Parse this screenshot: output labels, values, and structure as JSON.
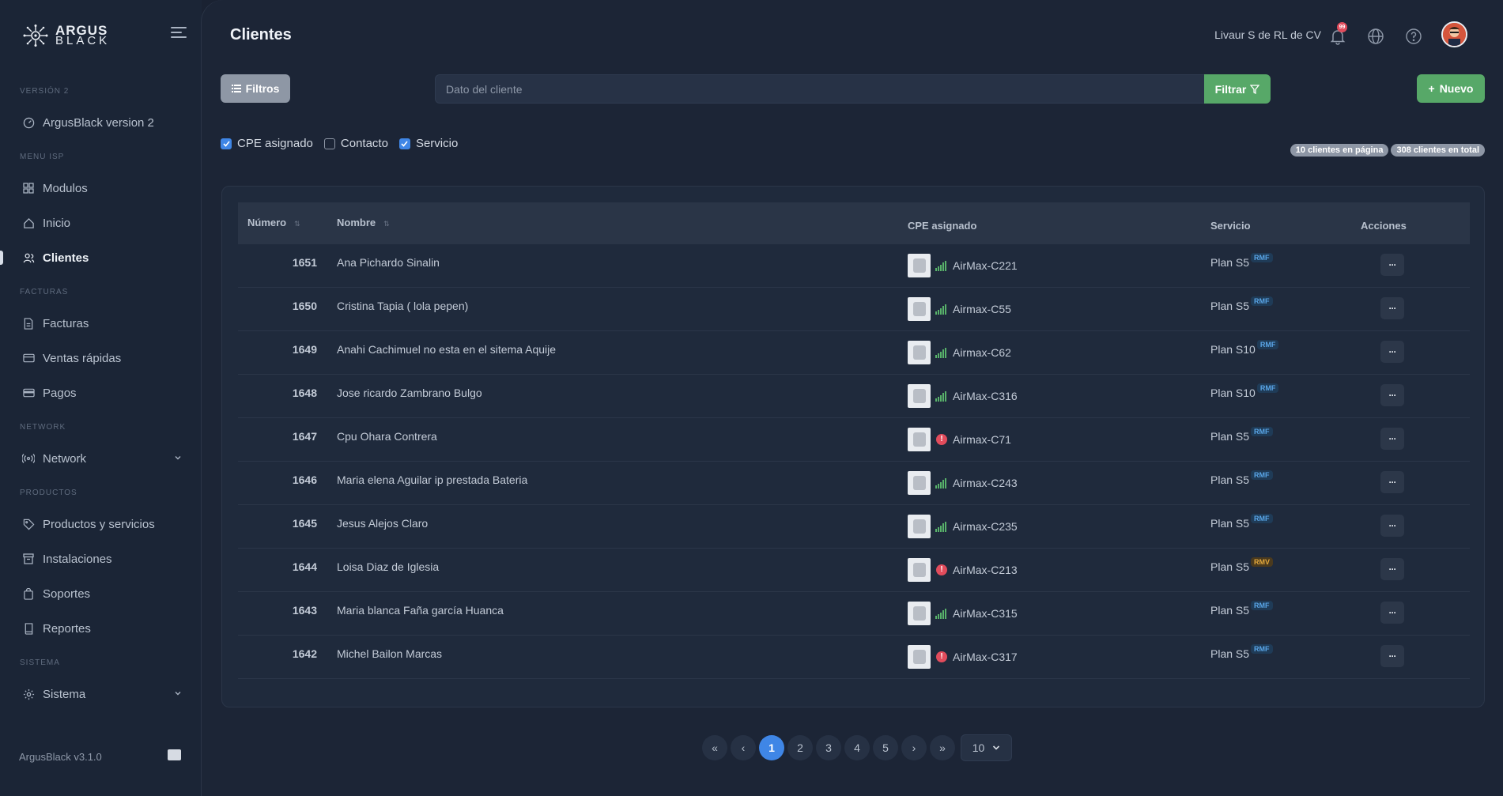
{
  "sidebar": {
    "logo_line1": "ARGUS",
    "logo_line2": "BLACK",
    "sections": [
      "VERSIÓN 2",
      "MENU ISP",
      "FACTURAS",
      "NETWORK",
      "PRODUCTOS",
      "SISTEMA"
    ],
    "items": [
      {
        "label": "ArgusBlack version 2",
        "icon": "gauge-icon"
      },
      {
        "label": "Modulos",
        "icon": "grid-icon"
      },
      {
        "label": "Inicio",
        "icon": "home-icon"
      },
      {
        "label": "Clientes",
        "icon": "users-icon"
      },
      {
        "label": "Facturas",
        "icon": "document-icon"
      },
      {
        "label": "Ventas rápidas",
        "icon": "card-icon"
      },
      {
        "label": "Pagos",
        "icon": "wallet-icon"
      },
      {
        "label": "Network",
        "icon": "broadcast-icon"
      },
      {
        "label": "Productos y servicios",
        "icon": "tag-icon"
      },
      {
        "label": "Instalaciones",
        "icon": "archive-icon"
      },
      {
        "label": "Soportes",
        "icon": "bag-icon"
      },
      {
        "label": "Reportes",
        "icon": "book-icon"
      },
      {
        "label": "Sistema",
        "icon": "gear-icon"
      }
    ],
    "version": "ArgusBlack v3.1.0"
  },
  "header": {
    "title": "Clientes",
    "company": "Livaur S de RL de CV",
    "notification_count": "99"
  },
  "toolbar": {
    "filtros_label": "Filtros",
    "search_placeholder": "Dato del cliente",
    "filtrar_label": "Filtrar",
    "nuevo_label": "Nuevo"
  },
  "checks": [
    {
      "label": "CPE asignado",
      "checked": true
    },
    {
      "label": "Contacto",
      "checked": false
    },
    {
      "label": "Servicio",
      "checked": true
    }
  ],
  "counts": {
    "page": "10 clientes en página",
    "total": "308 clientes en total"
  },
  "table": {
    "headers": {
      "numero": "Número",
      "nombre": "Nombre",
      "cpe": "CPE asignado",
      "servicio": "Servicio",
      "acciones": "Acciones"
    },
    "rows": [
      {
        "num": "1651",
        "name": "Ana Pichardo Sinalin",
        "cpe": "AirMax-C221",
        "status": "signal",
        "plan": "Plan S5",
        "tag": "RMF"
      },
      {
        "num": "1650",
        "name": "Cristina Tapia ( lola pepen)",
        "cpe": "Airmax-C55",
        "status": "signal",
        "plan": "Plan S5",
        "tag": "RMF"
      },
      {
        "num": "1649",
        "name": "Anahi Cachimuel no esta en el sitema Aquije",
        "cpe": "Airmax-C62",
        "status": "signal",
        "plan": "Plan S10",
        "tag": "RMF"
      },
      {
        "num": "1648",
        "name": "Jose ricardo Zambrano Bulgo",
        "cpe": "AirMax-C316",
        "status": "signal",
        "plan": "Plan S10",
        "tag": "RMF"
      },
      {
        "num": "1647",
        "name": "Cpu Ohara Contrera",
        "cpe": "Airmax-C71",
        "status": "error",
        "plan": "Plan S5",
        "tag": "RMF"
      },
      {
        "num": "1646",
        "name": "Maria elena Aguilar ip prestada Bateria",
        "cpe": "Airmax-C243",
        "status": "signal",
        "plan": "Plan S5",
        "tag": "RMF"
      },
      {
        "num": "1645",
        "name": "Jesus Alejos Claro",
        "cpe": "Airmax-C235",
        "status": "signal",
        "plan": "Plan S5",
        "tag": "RMF"
      },
      {
        "num": "1644",
        "name": "Loisa Diaz de Iglesia",
        "cpe": "AirMax-C213",
        "status": "error",
        "plan": "Plan S5",
        "tag": "RMV"
      },
      {
        "num": "1643",
        "name": "Maria blanca Faña garcía Huanca",
        "cpe": "AirMax-C315",
        "status": "signal",
        "plan": "Plan S5",
        "tag": "RMF"
      },
      {
        "num": "1642",
        "name": "Michel Bailon Marcas",
        "cpe": "AirMax-C317",
        "status": "error",
        "plan": "Plan S5",
        "tag": "RMF"
      }
    ],
    "action_label": "···"
  },
  "pagination": {
    "first": "«",
    "prev": "‹",
    "pages": [
      "1",
      "2",
      "3",
      "4",
      "5"
    ],
    "current": "1",
    "next": "›",
    "last": "»",
    "per_page": "10"
  },
  "colors": {
    "accent": "#3f86e6",
    "success": "#57a868",
    "danger": "#e24c5c"
  }
}
